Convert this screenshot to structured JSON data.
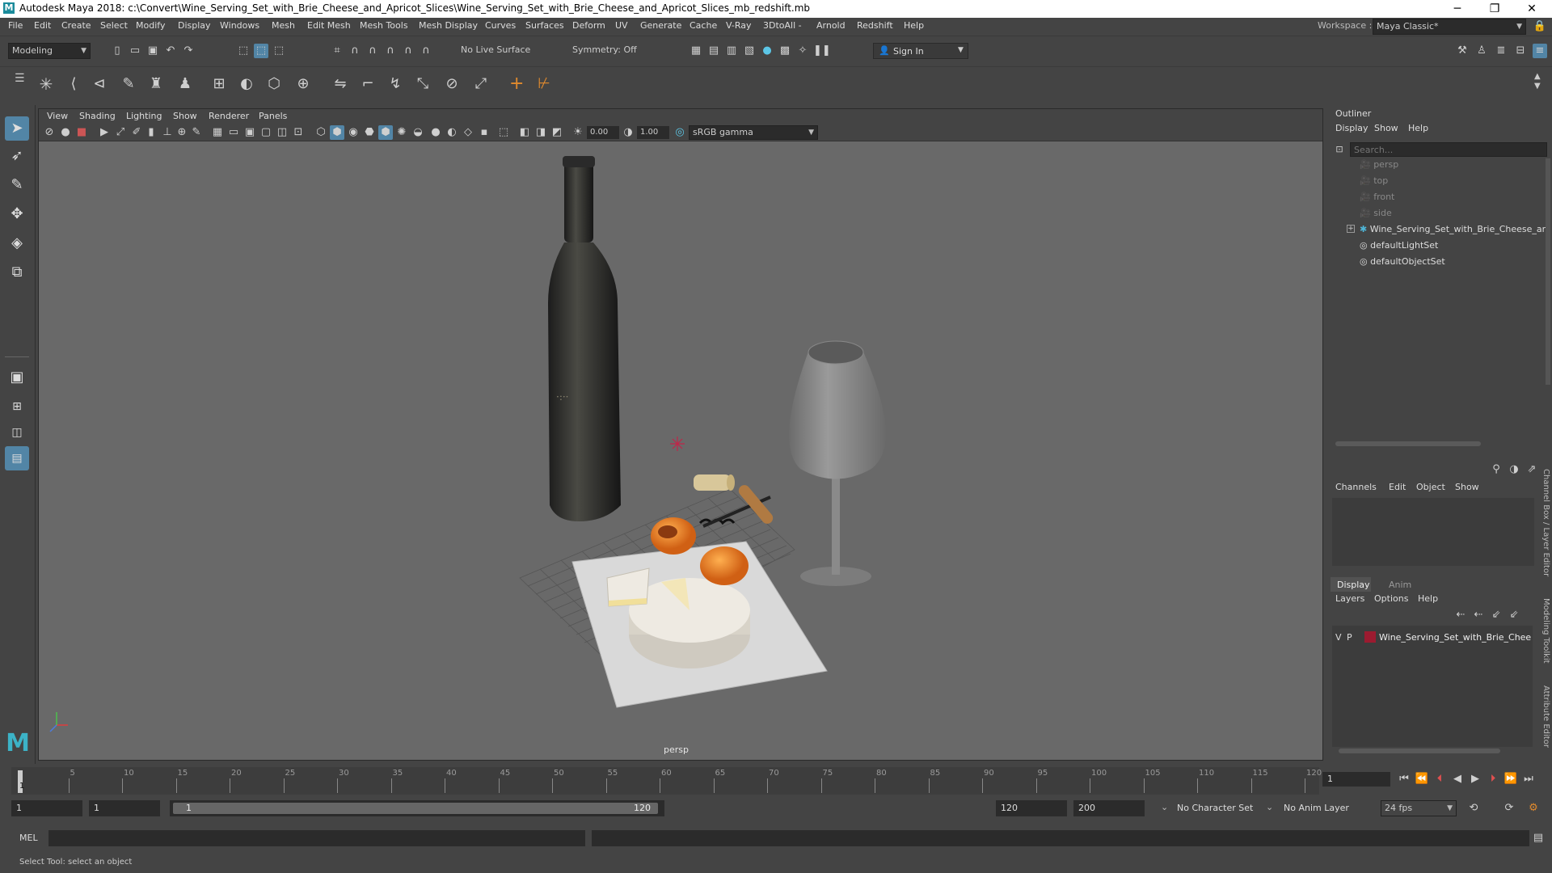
{
  "window": {
    "title": "Autodesk Maya 2018: c:\\Convert\\Wine_Serving_Set_with_Brie_Cheese_and_Apricot_Slices\\Wine_Serving_Set_with_Brie_Cheese_and_Apricot_Slices_mb_redshift.mb",
    "minimize": "─",
    "maximize": "❐",
    "close": "✕"
  },
  "menubar": {
    "items": [
      "File",
      "Edit",
      "Create",
      "Select",
      "Modify",
      "Display",
      "Windows",
      "Mesh",
      "Edit Mesh",
      "Mesh Tools",
      "Mesh Display",
      "Curves",
      "Surfaces",
      "Deform",
      "UV",
      "Generate",
      "Cache",
      "V-Ray",
      "3DtoAll -",
      "Arnold",
      "Redshift",
      "Help"
    ],
    "workspace_label": "Workspace :",
    "workspace_value": "Maya Classic*"
  },
  "statusline": {
    "mode": "Modeling",
    "live_surface": "No Live Surface",
    "symmetry": "Symmetry: Off",
    "sign_in": "Sign In"
  },
  "viewport": {
    "menus": [
      "View",
      "Shading",
      "Lighting",
      "Show",
      "Renderer",
      "Panels"
    ],
    "exposure": "0.00",
    "gamma": "1.00",
    "color_space": "sRGB gamma",
    "camera_label": "persp"
  },
  "outliner": {
    "title": "Outliner",
    "menus": [
      "Display",
      "Show",
      "Help"
    ],
    "search_placeholder": "Search...",
    "items": [
      {
        "label": "persp",
        "dim": true
      },
      {
        "label": "top",
        "dim": true
      },
      {
        "label": "front",
        "dim": true
      },
      {
        "label": "side",
        "dim": true
      },
      {
        "label": "Wine_Serving_Set_with_Brie_Cheese_an",
        "dim": false
      },
      {
        "label": "defaultLightSet",
        "dim": false
      },
      {
        "label": "defaultObjectSet",
        "dim": false
      }
    ]
  },
  "channelbox": {
    "menus": [
      "Channels",
      "Edit",
      "Object",
      "Show"
    ]
  },
  "layers": {
    "tabs": [
      "Display",
      "Anim"
    ],
    "menus": [
      "Layers",
      "Options",
      "Help"
    ],
    "layer": {
      "v": "V",
      "p": "P",
      "name": "Wine_Serving_Set_with_Brie_Cheese",
      "color": "#9b1b30"
    }
  },
  "side_tabs": [
    "Channel Box / Layer Editor",
    "Modeling Toolkit",
    "Attribute Editor"
  ],
  "timeline": {
    "ticks": [
      "5",
      "10",
      "15",
      "20",
      "25",
      "30",
      "35",
      "40",
      "45",
      "50",
      "55",
      "60",
      "65",
      "70",
      "75",
      "80",
      "85",
      "90",
      "95",
      "100",
      "105",
      "110",
      "115",
      "120"
    ],
    "start_tick": "1",
    "current_frame": "1"
  },
  "range": {
    "start": "1",
    "playback_start": "1",
    "slider_start": "1",
    "slider_end": "120",
    "playback_end": "120",
    "end": "200",
    "character_set": "No Character Set",
    "anim_layer": "No Anim Layer",
    "fps": "24 fps"
  },
  "cmdline": {
    "label": "MEL"
  },
  "helpline": {
    "text": "Select Tool: select an object"
  },
  "colors": {
    "accent": "#5285a6",
    "layer_red": "#9b1b30"
  }
}
